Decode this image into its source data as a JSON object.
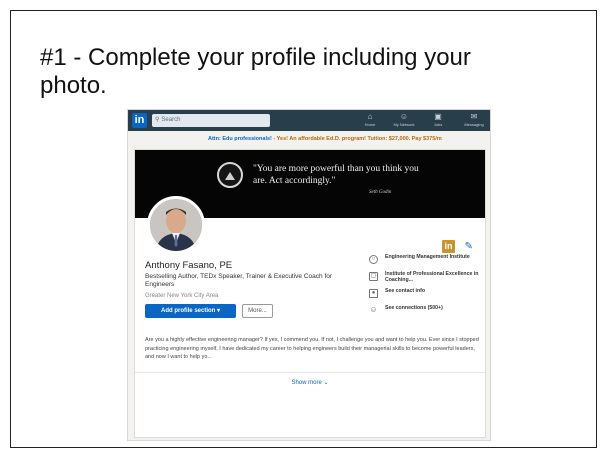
{
  "slide": {
    "title": "#1 - Complete your profile including your photo."
  },
  "nav": {
    "logo": "in",
    "search_placeholder": "Search",
    "items": [
      {
        "label": "Home",
        "icon": "home-icon"
      },
      {
        "label": "My Network",
        "icon": "network-icon"
      },
      {
        "label": "Jobs",
        "icon": "briefcase-icon"
      },
      {
        "label": "Messaging",
        "icon": "messaging-icon"
      }
    ]
  },
  "promo": {
    "link": "Attn: Edu professionals!",
    "text": " - Yes! An affordable Ed.D. program! Tuition: $27,000. Pay $375/m"
  },
  "banner": {
    "quote": "\"You are more powerful than you think you are. Act accordingly.\"",
    "author": "Seth Godin"
  },
  "profile": {
    "name": "Anthony Fasano, PE",
    "headline": "Bestselling Author, TEDx Speaker, Trainer & Executive Coach for Engineers",
    "location": "Greater New York City Area",
    "add_section_label": "Add profile section ▾",
    "more_label": "More...",
    "linkedin_badge": "in",
    "about": "Are you a highly effective engineering manager? If yes, I commend you. If not, I challenge you and want to help you. Ever since I stopped practicing engineering myself, I have dedicated my career to helping engineers build their managerial skills to become powerful leaders, and now I want to help yo...",
    "show_more": "Show more ⌄"
  },
  "sidebar": [
    {
      "text": "Engineering Management Institute",
      "icon": "company-icon"
    },
    {
      "text": "Institute of Professional Excellence in Coaching...",
      "icon": "school-icon"
    },
    {
      "text": "See contact info",
      "icon": "contact-icon"
    },
    {
      "text": "See connections (500+)",
      "icon": "connections-icon"
    }
  ],
  "colors": {
    "linkedin_blue": "#0a66c2",
    "nav_bg": "#283e4a",
    "banner_bg": "#050505",
    "badge_gold": "#c9932d"
  }
}
